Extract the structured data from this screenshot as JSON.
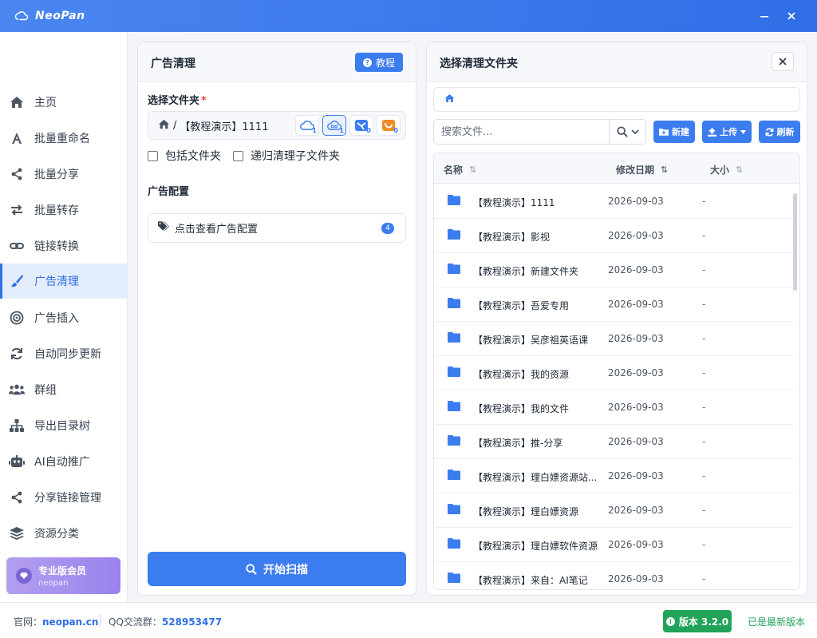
{
  "app": {
    "name": "NeoPan"
  },
  "sidebar": {
    "items": [
      {
        "label": "主页",
        "icon": "home-icon"
      },
      {
        "label": "批量重命名",
        "icon": "font-icon"
      },
      {
        "label": "批量分享",
        "icon": "share-icon"
      },
      {
        "label": "批量转存",
        "icon": "exchange-icon"
      },
      {
        "label": "链接转换",
        "icon": "link-icon"
      },
      {
        "label": "广告清理",
        "icon": "brush-icon",
        "active": true
      },
      {
        "label": "广告插入",
        "icon": "target-icon"
      },
      {
        "label": "自动同步更新",
        "icon": "sync-icon"
      },
      {
        "label": "群组",
        "icon": "users-icon"
      },
      {
        "label": "导出目录树",
        "icon": "sitemap-icon"
      },
      {
        "label": "AI自动推广",
        "icon": "robot-icon"
      },
      {
        "label": "分享链接管理",
        "icon": "share-alt-icon"
      },
      {
        "label": "资源分类",
        "icon": "layers-icon"
      }
    ],
    "vip": {
      "title": "专业版会员",
      "subtitle": "neopan"
    }
  },
  "left_panel": {
    "title": "广告清理",
    "tutorial_label": "教程",
    "select_folder_label": "选择文件夹",
    "required_mark": "*",
    "path_separator": "/",
    "path_value": "【教程演示】1111",
    "drives": [
      {
        "icon": "cloud-drive-icon",
        "count": "1"
      },
      {
        "icon": "baidu-drive-icon",
        "count": "1",
        "selected": true
      },
      {
        "icon": "tianyi-drive-icon",
        "count": "0"
      },
      {
        "icon": "uc-drive-icon",
        "count": "0"
      }
    ],
    "include_folder_label": "包括文件夹",
    "recursive_label": "递归清理子文件夹",
    "ad_config_label": "广告配置",
    "ad_config_link": "点击查看广告配置",
    "ad_config_count": "4",
    "scan_label": "开始扫描"
  },
  "right_panel": {
    "title": "选择清理文件夹",
    "search_placeholder": "搜索文件...",
    "btn_new": "新建",
    "btn_upload": "上传",
    "btn_refresh": "刷新",
    "columns": {
      "name": "名称",
      "date": "修改日期",
      "size": "大小"
    },
    "rows": [
      {
        "name": "【教程演示】1111",
        "date": "2026-09-03",
        "size": "-"
      },
      {
        "name": "【教程演示】影视",
        "date": "2026-09-03",
        "size": "-"
      },
      {
        "name": "【教程演示】新建文件夹",
        "date": "2026-09-03",
        "size": "-"
      },
      {
        "name": "【教程演示】吾爱专用",
        "date": "2026-09-03",
        "size": "-"
      },
      {
        "name": "【教程演示】吴彦祖英语课",
        "date": "2026-09-03",
        "size": "-"
      },
      {
        "name": "【教程演示】我的资源",
        "date": "2026-09-03",
        "size": "-"
      },
      {
        "name": "【教程演示】我的文件",
        "date": "2026-09-03",
        "size": "-"
      },
      {
        "name": "【教程演示】推-分享",
        "date": "2026-09-03",
        "size": "-"
      },
      {
        "name": "【教程演示】理白嫖资源站...",
        "date": "2026-09-03",
        "size": "-"
      },
      {
        "name": "【教程演示】理白嫖资源",
        "date": "2026-09-03",
        "size": "-"
      },
      {
        "name": "【教程演示】理白嫖软件资源",
        "date": "2026-09-03",
        "size": "-"
      },
      {
        "name": "【教程演示】来自：AI笔记",
        "date": "2026-09-03",
        "size": "-"
      }
    ]
  },
  "footer": {
    "site_label": "官网：",
    "site_value": "neopan.cn",
    "qq_label": "QQ交流群：",
    "qq_value": "528953477",
    "version_label": "版本 3.2.0",
    "latest_label": "已是最新版本"
  },
  "colors": {
    "accent": "#3b7cef",
    "success": "#22a35a",
    "danger": "#ef4444"
  }
}
